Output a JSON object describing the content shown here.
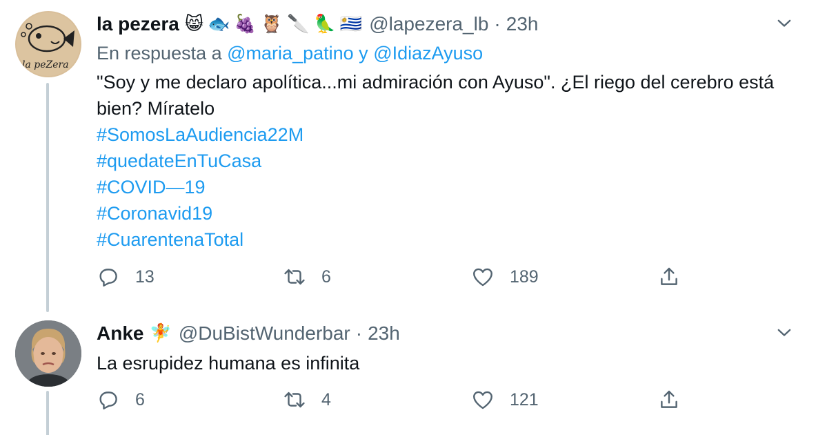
{
  "tweets": [
    {
      "display_name": "la pezera",
      "emojis": [
        "😸",
        "🐟",
        "🍇",
        "🦉",
        "🔪",
        "🦜",
        "🇺🇾"
      ],
      "handle": "@lapezera_lb",
      "separator": "·",
      "time": "23h",
      "avatar_text": "la peZera",
      "reply_prefix": "En respuesta a",
      "reply_to_1": "@maria_patino",
      "reply_joiner": "y",
      "reply_to_2": "@IdiazAyuso",
      "text": "\"Soy y me declaro apolítica...mi admiración con Ayuso\". ¿El riego del cerebro está bien? Míratelo",
      "hashtags": [
        "#SomosLaAudiencia22M",
        "#quedateEnTuCasa",
        "#COVID—19",
        "#Coronavid19",
        "#CuarentenaTotal"
      ],
      "replies": "13",
      "retweets": "6",
      "likes": "189"
    },
    {
      "display_name": "Anke",
      "emojis": [
        "🧚"
      ],
      "handle": "@DuBistWunderbar",
      "separator": "·",
      "time": "23h",
      "text": "La esrupidez humana es infinita",
      "replies": "6",
      "retweets": "4",
      "likes": "121"
    }
  ],
  "icons": {
    "reply": "reply-icon",
    "retweet": "retweet-icon",
    "like": "like-icon",
    "share": "share-icon",
    "more": "chevron-down-icon"
  },
  "colors": {
    "link": "#1d9bf0",
    "secondary_text": "#536471",
    "thread_line": "#c4cfd6"
  }
}
